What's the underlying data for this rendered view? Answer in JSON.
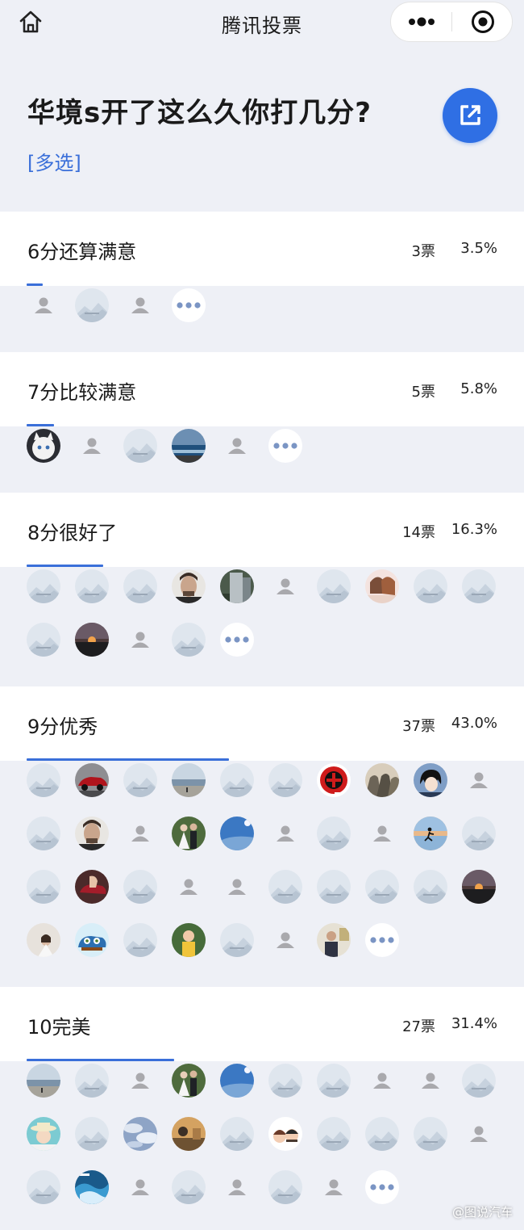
{
  "app": {
    "title": "腾讯投票"
  },
  "icons": {
    "home": "home-icon",
    "more": "more-dots-icon",
    "close": "mini-program-close-icon",
    "share": "external-link-icon"
  },
  "colors": {
    "accent": "#3a6fd9",
    "share_bg": "#2f6fe4",
    "page_bg": "#eef0f6"
  },
  "question": {
    "title": "华境s开了这么久你打几分?",
    "type": "[多选]"
  },
  "options": [
    {
      "label": "6分还算满意",
      "votes": "3票",
      "percent": "3.5%",
      "share": 0.035,
      "avatars": [
        "person",
        "mountain",
        "person",
        "more"
      ]
    },
    {
      "label": "7分比较满意",
      "votes": "5票",
      "percent": "5.8%",
      "share": 0.058,
      "avatars": [
        "cat",
        "person",
        "mountain",
        "sea",
        "person",
        "more"
      ]
    },
    {
      "label": "8分很好了",
      "votes": "14票",
      "percent": "16.3%",
      "share": 0.163,
      "avatars": [
        "mountain",
        "mountain",
        "mountain",
        "face",
        "building",
        "person",
        "mountain",
        "couple",
        "mountain",
        "mountain",
        "mountain",
        "sunset",
        "person",
        "mountain",
        "more"
      ]
    },
    {
      "label": "9分优秀",
      "votes": "37票",
      "percent": "43.0%",
      "share": 0.43,
      "avatars": [
        "mountain",
        "car",
        "mountain",
        "beach",
        "mountain",
        "mountain",
        "badge",
        "group",
        "anime",
        "person",
        "mountain",
        "face",
        "person",
        "wedding",
        "sky",
        "person",
        "mountain",
        "person",
        "runner",
        "mountain",
        "mountain",
        "hand",
        "mountain",
        "person",
        "person",
        "mountain",
        "mountain",
        "mountain",
        "mountain",
        "sunset",
        "bride",
        "cartoon",
        "mountain",
        "kid",
        "mountain",
        "person",
        "office",
        "more"
      ]
    },
    {
      "label": "10完美",
      "votes": "27票",
      "percent": "31.4%",
      "share": 0.314,
      "avatars": [
        "beach",
        "mountain",
        "person",
        "wedding",
        "sky",
        "mountain",
        "mountain",
        "person",
        "person",
        "mountain",
        "hat",
        "mountain",
        "clouds",
        "pet",
        "mountain",
        "emoji",
        "mountain",
        "mountain",
        "mountain",
        "person",
        "mountain",
        "ocean",
        "person",
        "mountain",
        "person",
        "mountain",
        "person",
        "more"
      ]
    }
  ],
  "watermark": "@图说汽车"
}
